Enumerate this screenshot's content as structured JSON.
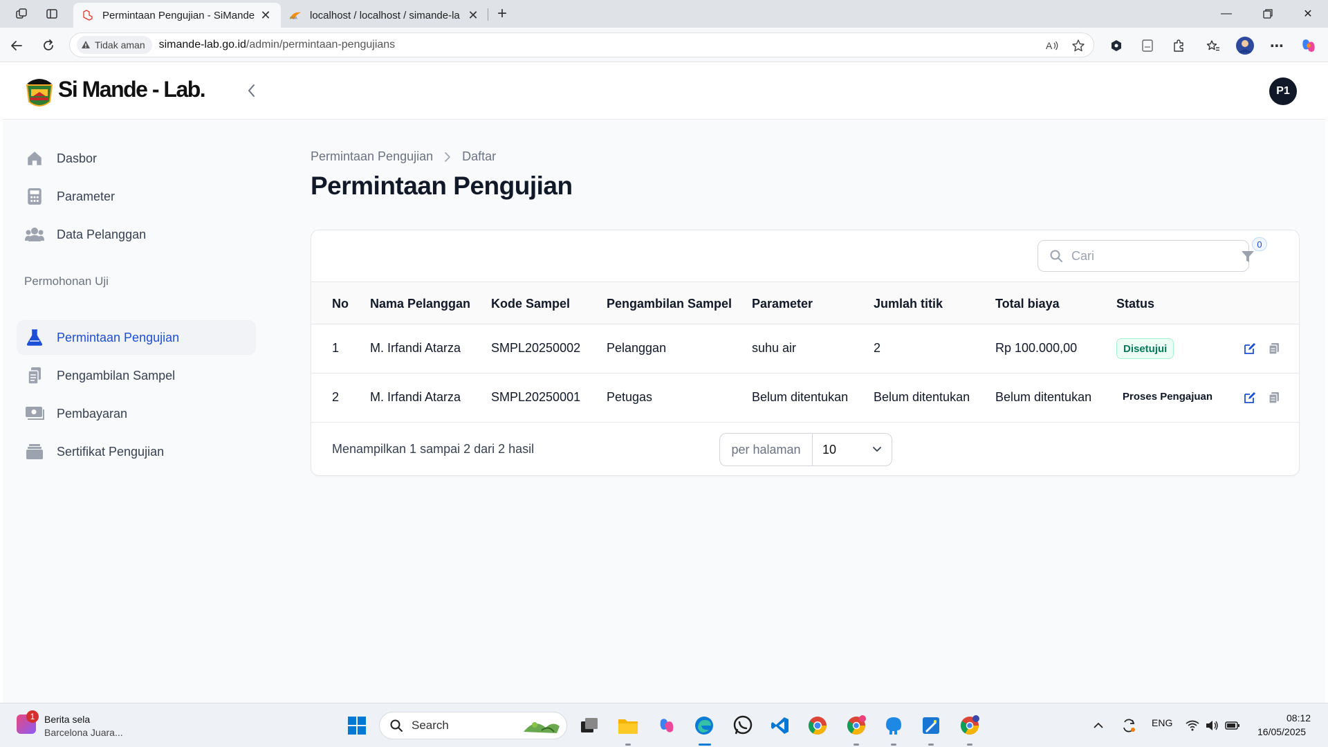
{
  "browser": {
    "tabs": [
      {
        "title": "Permintaan Pengujian - SiMande-",
        "active": true
      },
      {
        "title": "localhost / localhost / simande-la",
        "active": false
      }
    ],
    "security_label": "Tidak aman",
    "url_host": "simande-lab.go.id",
    "url_path": "/admin/permintaan-pengujians"
  },
  "app": {
    "brand": "Si Mande - Lab.",
    "user_initials": "P1"
  },
  "sidebar": {
    "items": [
      {
        "label": "Dasbor",
        "icon": "home-icon"
      },
      {
        "label": "Parameter",
        "icon": "calculator-icon"
      },
      {
        "label": "Data Pelanggan",
        "icon": "users-icon"
      }
    ],
    "group_label": "Permohonan Uji",
    "group_items": [
      {
        "label": "Permintaan Pengujian",
        "icon": "beaker-icon",
        "active": true
      },
      {
        "label": "Pengambilan Sampel",
        "icon": "clipboard-icon"
      },
      {
        "label": "Pembayaran",
        "icon": "cash-icon"
      },
      {
        "label": "Sertifikat Pengujian",
        "icon": "archive-icon"
      }
    ]
  },
  "page": {
    "breadcrumb": [
      "Permintaan Pengujian",
      "Daftar"
    ],
    "title": "Permintaan Pengujian"
  },
  "table": {
    "search_placeholder": "Cari",
    "filter_count": "0",
    "columns": [
      "No",
      "Nama Pelanggan",
      "Kode Sampel",
      "Pengambilan Sampel",
      "Parameter",
      "Jumlah titik",
      "Total biaya",
      "Status"
    ],
    "rows": [
      {
        "no": "1",
        "nama": "M. Irfandi Atarza",
        "kode": "SMPL20250002",
        "pengambilan": "Pelanggan",
        "parameter": "suhu air",
        "jumlah": "2",
        "biaya": "Rp 100.000,00",
        "status": "Disetujui"
      },
      {
        "no": "2",
        "nama": "M. Irfandi Atarza",
        "kode": "SMPL20250001",
        "pengambilan": "Petugas",
        "parameter": "Belum ditentukan",
        "jumlah": "Belum ditentukan",
        "biaya": "Belum ditentukan",
        "status": "Proses Pengajuan"
      }
    ],
    "summary": "Menampilkan 1 sampai 2 dari 2 hasil",
    "per_page_label": "per halaman",
    "per_page_value": "10"
  },
  "taskbar": {
    "news_badge": "1",
    "news_title": "Berita sela",
    "news_subtitle": "Barcelona Juara...",
    "search_label": "Search",
    "language": "ENG",
    "time": "08:12",
    "date": "16/05/2025"
  },
  "colors": {
    "accent": "#1d4ed8",
    "success_bg": "#ecfdf5",
    "success_text": "#047857"
  }
}
